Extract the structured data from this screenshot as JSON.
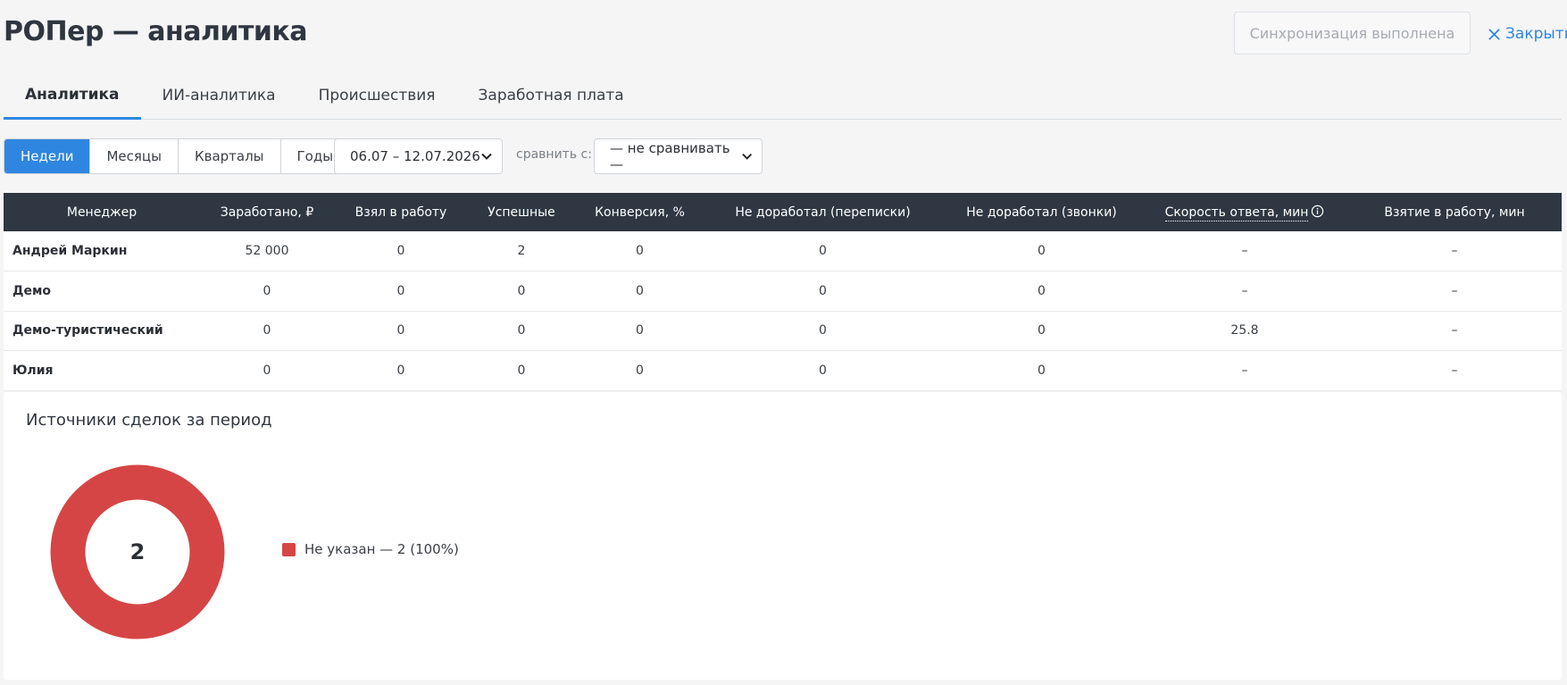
{
  "header": {
    "title": "РОПер — аналитика",
    "sync_label": "Синхронизация выполнена",
    "close_label": "Закрыть"
  },
  "tabs": [
    {
      "label": "Аналитика",
      "active": true
    },
    {
      "label": "ИИ-аналитика",
      "active": false
    },
    {
      "label": "Происшествия",
      "active": false
    },
    {
      "label": "Заработная плата",
      "active": false
    }
  ],
  "filters": {
    "periods": [
      {
        "label": "Недели",
        "active": true
      },
      {
        "label": "Месяцы",
        "active": false
      },
      {
        "label": "Кварталы",
        "active": false
      },
      {
        "label": "Годы",
        "active": false
      }
    ],
    "date_range": "06.07 – 12.07.2026",
    "compare_label": "сравнить с:",
    "compare_value": "— не сравнивать —"
  },
  "table": {
    "columns": [
      "Менеджер",
      "Заработано, ₽",
      "Взял в работу",
      "Успешные",
      "Конверсия, %",
      "Не доработал (переписки)",
      "Не доработал (звонки)",
      "Скорость ответа, мин",
      "Взятие в работу, мин"
    ],
    "rows": [
      [
        "Андрей Маркин",
        "52 000",
        "0",
        "2",
        "0",
        "0",
        "0",
        "–",
        "–"
      ],
      [
        "Демо",
        "0",
        "0",
        "0",
        "0",
        "0",
        "0",
        "–",
        "–"
      ],
      [
        "Демо-туристический",
        "0",
        "0",
        "0",
        "0",
        "0",
        "0",
        "25.8",
        "–"
      ],
      [
        "Юлия",
        "0",
        "0",
        "0",
        "0",
        "0",
        "0",
        "–",
        "–"
      ]
    ]
  },
  "sources_card": {
    "title": "Источники сделок за период",
    "total": "2",
    "legend": [
      {
        "label": "Не указан — 2 (100%)",
        "color": "#d64545"
      }
    ]
  },
  "chart_data": {
    "type": "pie",
    "categories": [
      "Не указан"
    ],
    "values": [
      2
    ],
    "title": "Источники сделок за период"
  },
  "colors": {
    "accent": "#2f86e0",
    "header_bg": "#2e3742",
    "donut": "#d64545"
  }
}
